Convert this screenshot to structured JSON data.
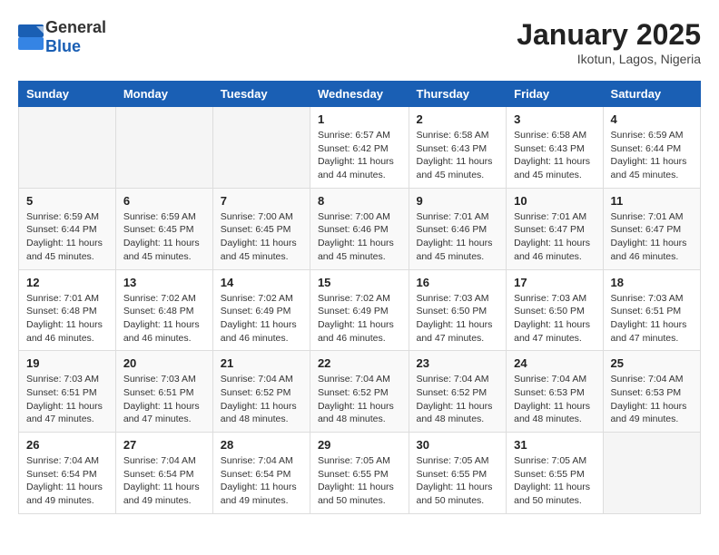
{
  "header": {
    "logo_general": "General",
    "logo_blue": "Blue",
    "month_year": "January 2025",
    "location": "Ikotun, Lagos, Nigeria"
  },
  "weekdays": [
    "Sunday",
    "Monday",
    "Tuesday",
    "Wednesday",
    "Thursday",
    "Friday",
    "Saturday"
  ],
  "weeks": [
    [
      {
        "day": "",
        "info": ""
      },
      {
        "day": "",
        "info": ""
      },
      {
        "day": "",
        "info": ""
      },
      {
        "day": "1",
        "info": "Sunrise: 6:57 AM\nSunset: 6:42 PM\nDaylight: 11 hours\nand 44 minutes."
      },
      {
        "day": "2",
        "info": "Sunrise: 6:58 AM\nSunset: 6:43 PM\nDaylight: 11 hours\nand 45 minutes."
      },
      {
        "day": "3",
        "info": "Sunrise: 6:58 AM\nSunset: 6:43 PM\nDaylight: 11 hours\nand 45 minutes."
      },
      {
        "day": "4",
        "info": "Sunrise: 6:59 AM\nSunset: 6:44 PM\nDaylight: 11 hours\nand 45 minutes."
      }
    ],
    [
      {
        "day": "5",
        "info": "Sunrise: 6:59 AM\nSunset: 6:44 PM\nDaylight: 11 hours\nand 45 minutes."
      },
      {
        "day": "6",
        "info": "Sunrise: 6:59 AM\nSunset: 6:45 PM\nDaylight: 11 hours\nand 45 minutes."
      },
      {
        "day": "7",
        "info": "Sunrise: 7:00 AM\nSunset: 6:45 PM\nDaylight: 11 hours\nand 45 minutes."
      },
      {
        "day": "8",
        "info": "Sunrise: 7:00 AM\nSunset: 6:46 PM\nDaylight: 11 hours\nand 45 minutes."
      },
      {
        "day": "9",
        "info": "Sunrise: 7:01 AM\nSunset: 6:46 PM\nDaylight: 11 hours\nand 45 minutes."
      },
      {
        "day": "10",
        "info": "Sunrise: 7:01 AM\nSunset: 6:47 PM\nDaylight: 11 hours\nand 46 minutes."
      },
      {
        "day": "11",
        "info": "Sunrise: 7:01 AM\nSunset: 6:47 PM\nDaylight: 11 hours\nand 46 minutes."
      }
    ],
    [
      {
        "day": "12",
        "info": "Sunrise: 7:01 AM\nSunset: 6:48 PM\nDaylight: 11 hours\nand 46 minutes."
      },
      {
        "day": "13",
        "info": "Sunrise: 7:02 AM\nSunset: 6:48 PM\nDaylight: 11 hours\nand 46 minutes."
      },
      {
        "day": "14",
        "info": "Sunrise: 7:02 AM\nSunset: 6:49 PM\nDaylight: 11 hours\nand 46 minutes."
      },
      {
        "day": "15",
        "info": "Sunrise: 7:02 AM\nSunset: 6:49 PM\nDaylight: 11 hours\nand 46 minutes."
      },
      {
        "day": "16",
        "info": "Sunrise: 7:03 AM\nSunset: 6:50 PM\nDaylight: 11 hours\nand 47 minutes."
      },
      {
        "day": "17",
        "info": "Sunrise: 7:03 AM\nSunset: 6:50 PM\nDaylight: 11 hours\nand 47 minutes."
      },
      {
        "day": "18",
        "info": "Sunrise: 7:03 AM\nSunset: 6:51 PM\nDaylight: 11 hours\nand 47 minutes."
      }
    ],
    [
      {
        "day": "19",
        "info": "Sunrise: 7:03 AM\nSunset: 6:51 PM\nDaylight: 11 hours\nand 47 minutes."
      },
      {
        "day": "20",
        "info": "Sunrise: 7:03 AM\nSunset: 6:51 PM\nDaylight: 11 hours\nand 47 minutes."
      },
      {
        "day": "21",
        "info": "Sunrise: 7:04 AM\nSunset: 6:52 PM\nDaylight: 11 hours\nand 48 minutes."
      },
      {
        "day": "22",
        "info": "Sunrise: 7:04 AM\nSunset: 6:52 PM\nDaylight: 11 hours\nand 48 minutes."
      },
      {
        "day": "23",
        "info": "Sunrise: 7:04 AM\nSunset: 6:52 PM\nDaylight: 11 hours\nand 48 minutes."
      },
      {
        "day": "24",
        "info": "Sunrise: 7:04 AM\nSunset: 6:53 PM\nDaylight: 11 hours\nand 48 minutes."
      },
      {
        "day": "25",
        "info": "Sunrise: 7:04 AM\nSunset: 6:53 PM\nDaylight: 11 hours\nand 49 minutes."
      }
    ],
    [
      {
        "day": "26",
        "info": "Sunrise: 7:04 AM\nSunset: 6:54 PM\nDaylight: 11 hours\nand 49 minutes."
      },
      {
        "day": "27",
        "info": "Sunrise: 7:04 AM\nSunset: 6:54 PM\nDaylight: 11 hours\nand 49 minutes."
      },
      {
        "day": "28",
        "info": "Sunrise: 7:04 AM\nSunset: 6:54 PM\nDaylight: 11 hours\nand 49 minutes."
      },
      {
        "day": "29",
        "info": "Sunrise: 7:05 AM\nSunset: 6:55 PM\nDaylight: 11 hours\nand 50 minutes."
      },
      {
        "day": "30",
        "info": "Sunrise: 7:05 AM\nSunset: 6:55 PM\nDaylight: 11 hours\nand 50 minutes."
      },
      {
        "day": "31",
        "info": "Sunrise: 7:05 AM\nSunset: 6:55 PM\nDaylight: 11 hours\nand 50 minutes."
      },
      {
        "day": "",
        "info": ""
      }
    ]
  ]
}
